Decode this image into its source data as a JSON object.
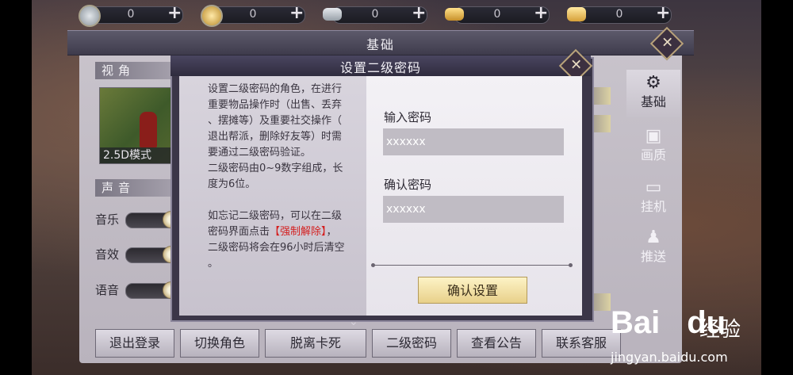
{
  "currency": [
    {
      "icon": "silver-coin-icon",
      "value": "0"
    },
    {
      "icon": "gold-coin-icon",
      "value": "0"
    },
    {
      "icon": "silver-ingot-icon",
      "value": "0"
    },
    {
      "icon": "gold-ingot-icon",
      "value": "0"
    },
    {
      "icon": "gold-ingot-stack-icon",
      "value": "0"
    }
  ],
  "panel": {
    "title": "基础"
  },
  "left": {
    "view_section": "视角",
    "view_mode": "2.5D模式",
    "sound_section": "声音",
    "sliders": [
      {
        "label": "音乐",
        "level": 1.0
      },
      {
        "label": "音效",
        "level": 1.0
      },
      {
        "label": "语音",
        "level": 1.0
      }
    ]
  },
  "tabs": [
    {
      "icon": "gear-icon",
      "label": "基础",
      "active": true
    },
    {
      "icon": "monitor-image-icon",
      "label": "画质",
      "active": false
    },
    {
      "icon": "monitor-icon",
      "label": "挂机",
      "active": false
    },
    {
      "icon": "bell-icon",
      "label": "推送",
      "active": false
    }
  ],
  "bottom_buttons": [
    "退出登录",
    "切换角色",
    "脱离卡死",
    "二级密码",
    "查看公告",
    "联系客服"
  ],
  "dialog": {
    "title": "设置二级密码",
    "desc_lines": [
      "设置二级密码的角色，在进行",
      "重要物品操作时（出售、丢弃",
      "、摆摊等）及重要社交操作（",
      "退出帮派，删除好友等）时需",
      "要通过二级密码验证。",
      "二级密码由0~9数字组成，长",
      "度为6位。"
    ],
    "forgot_line1": "如忘记二级密码，可以在二级",
    "forgot_prefix": "密码界面点击",
    "forgot_link": "【强制解除】",
    "forgot_suffix": "，",
    "forgot_line3": "二级密码将会在96小时后清空",
    "forgot_line4": "。",
    "enter_label": "输入密码",
    "enter_value": "xxxxxx",
    "confirm_label": "确认密码",
    "confirm_value": "xxxxxx",
    "confirm_button": "确认设置"
  },
  "watermark": {
    "brand": "Bai",
    "brand_tail": "du",
    "brand_cn": "经验",
    "url": "jingyan.baidu.com"
  },
  "colors": {
    "accent_gold": "#e8d08a",
    "link_red": "#d41f1f",
    "panel_bg": "#c9c4cc"
  }
}
